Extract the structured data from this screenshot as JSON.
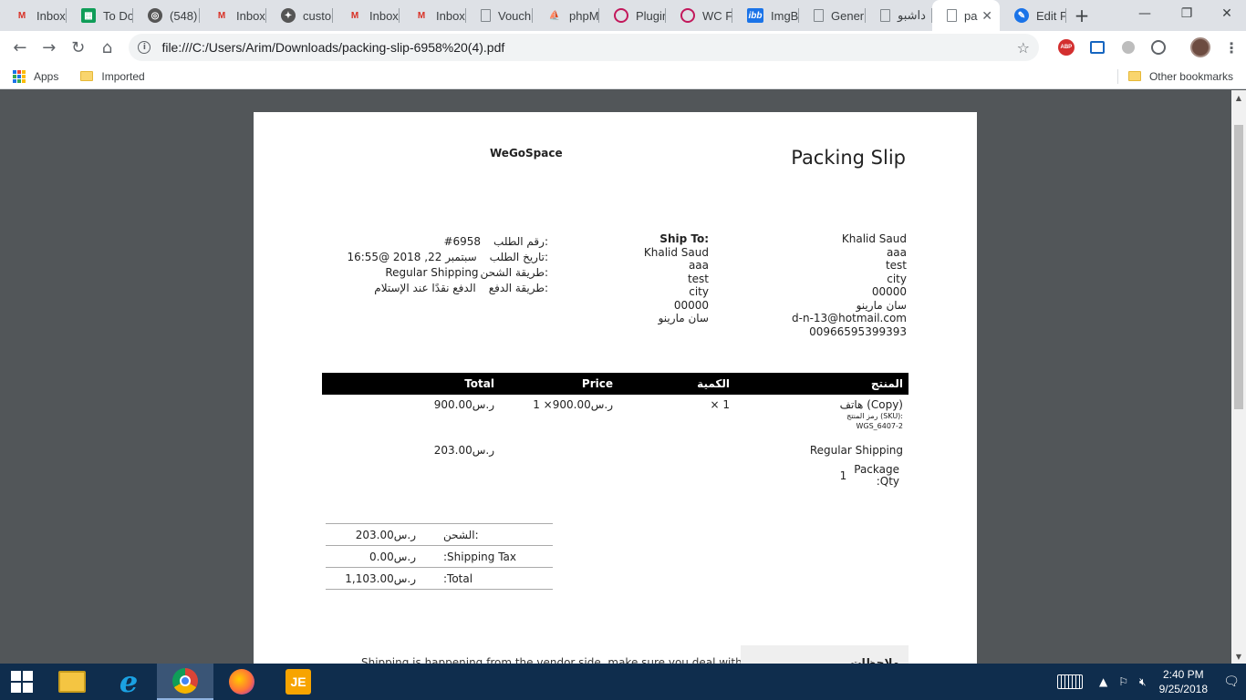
{
  "tabs": [
    {
      "label": "Inbox",
      "icon": "gmail-icon",
      "glyph": "M",
      "kind": "gmail"
    },
    {
      "label": "To Do",
      "icon": "sheets-icon",
      "glyph": "▦",
      "kind": "sheets"
    },
    {
      "label": "(548)",
      "icon": "mail-app-icon",
      "glyph": "◎",
      "kind": "circle"
    },
    {
      "label": "Inbox",
      "icon": "gmail-icon",
      "glyph": "M",
      "kind": "gmail"
    },
    {
      "label": "custor",
      "icon": "site-icon",
      "glyph": "✦",
      "kind": "circle"
    },
    {
      "label": "Inbox",
      "icon": "gmail-icon",
      "glyph": "M",
      "kind": "gmail"
    },
    {
      "label": "Inbox",
      "icon": "gmail-icon",
      "glyph": "M",
      "kind": "gmail"
    },
    {
      "label": "Vouch",
      "icon": "document-icon",
      "glyph": "",
      "kind": "generic"
    },
    {
      "label": "phpM",
      "icon": "phpmyadmin-icon",
      "glyph": "⛵",
      "kind": "pma"
    },
    {
      "label": "Plugin",
      "icon": "plugin-icon",
      "glyph": "",
      "kind": "pink"
    },
    {
      "label": "WC Fr",
      "icon": "plugin-icon",
      "glyph": "",
      "kind": "pink"
    },
    {
      "label": "ImgBB",
      "icon": "imgbb-icon",
      "glyph": "ibb",
      "kind": "ibb"
    },
    {
      "label": "Gener",
      "icon": "document-icon",
      "glyph": "",
      "kind": "generic"
    },
    {
      "label": "داشبو",
      "icon": "document-icon",
      "glyph": "",
      "kind": "generic"
    },
    {
      "label": "pa",
      "icon": "document-icon",
      "glyph": "",
      "kind": "generic",
      "active": true
    },
    {
      "label": "Edit Pa",
      "icon": "edit-icon",
      "glyph": "✎",
      "kind": "edit"
    }
  ],
  "toolbar": {
    "url": "file:///C:/Users/Arim/Downloads/packing-slip-6958%20(4).pdf",
    "back": "←",
    "forward": "→",
    "reload": "↻",
    "home": "⌂",
    "star": "☆",
    "abp": "ABP",
    "menu": "⋮",
    "info": "i"
  },
  "window": {
    "minimize": "—",
    "restore": "❐",
    "close": "✕",
    "new_tab": "+",
    "tab_close": "✕"
  },
  "bookmarks": {
    "apps": "Apps",
    "imported": "Imported",
    "other": "Other bookmarks"
  },
  "doc": {
    "shop_name": "WeGoSpace",
    "title": "Packing Slip",
    "order": [
      {
        "label": "رقم الطلب:",
        "value": "#6958"
      },
      {
        "label": "تاريخ الطلب:",
        "value": "سبتمبر 22, 2018 @16:55"
      },
      {
        "label": "طريقة الشحن:",
        "value": "Regular Shipping"
      },
      {
        "label": "طريقة الدفع:",
        "value": "الدفع نقدًا عند الإستلام"
      }
    ],
    "ship_to_label": "Ship To:",
    "ship_to": [
      "Khalid Saud",
      "aaa",
      "test",
      "city",
      "00000",
      "سان مارينو"
    ],
    "billing": [
      "Khalid Saud",
      "aaa",
      "test",
      "city",
      "00000",
      "سان مارينو",
      "d-n-13@hotmail.com",
      "00966595399393"
    ],
    "columns": {
      "total": "Total",
      "price": "Price",
      "qty": "الكمية",
      "product": "المنتج"
    },
    "item": {
      "name": "هاتف (Copy)",
      "sku_label": "رمز المنتج (SKU):",
      "sku": "WGS_6407-2",
      "qty": "× 1",
      "price": "ر.س900.00× 1",
      "total": "ر.س900.00"
    },
    "shipping_row": {
      "name": "Regular Shipping",
      "total": "ر.س203.00"
    },
    "package": {
      "label_line1": "Package",
      "label_line2": ":Qty",
      "value": "1"
    },
    "totals": [
      {
        "label": "الشحن:",
        "value": "ر.س203.00"
      },
      {
        "label": ":Shipping Tax",
        "value": "ر.س0.00"
      },
      {
        "label": ":Total",
        "value": "ر.س1,103.00"
      }
    ],
    "notes_text": "Shipping is happening from the vendor side, make sure you deal with high",
    "notes_head": "ملاحظات"
  },
  "taskbar": {
    "time": "2:40 PM",
    "date": "9/25/2018",
    "je_label": "JE"
  }
}
